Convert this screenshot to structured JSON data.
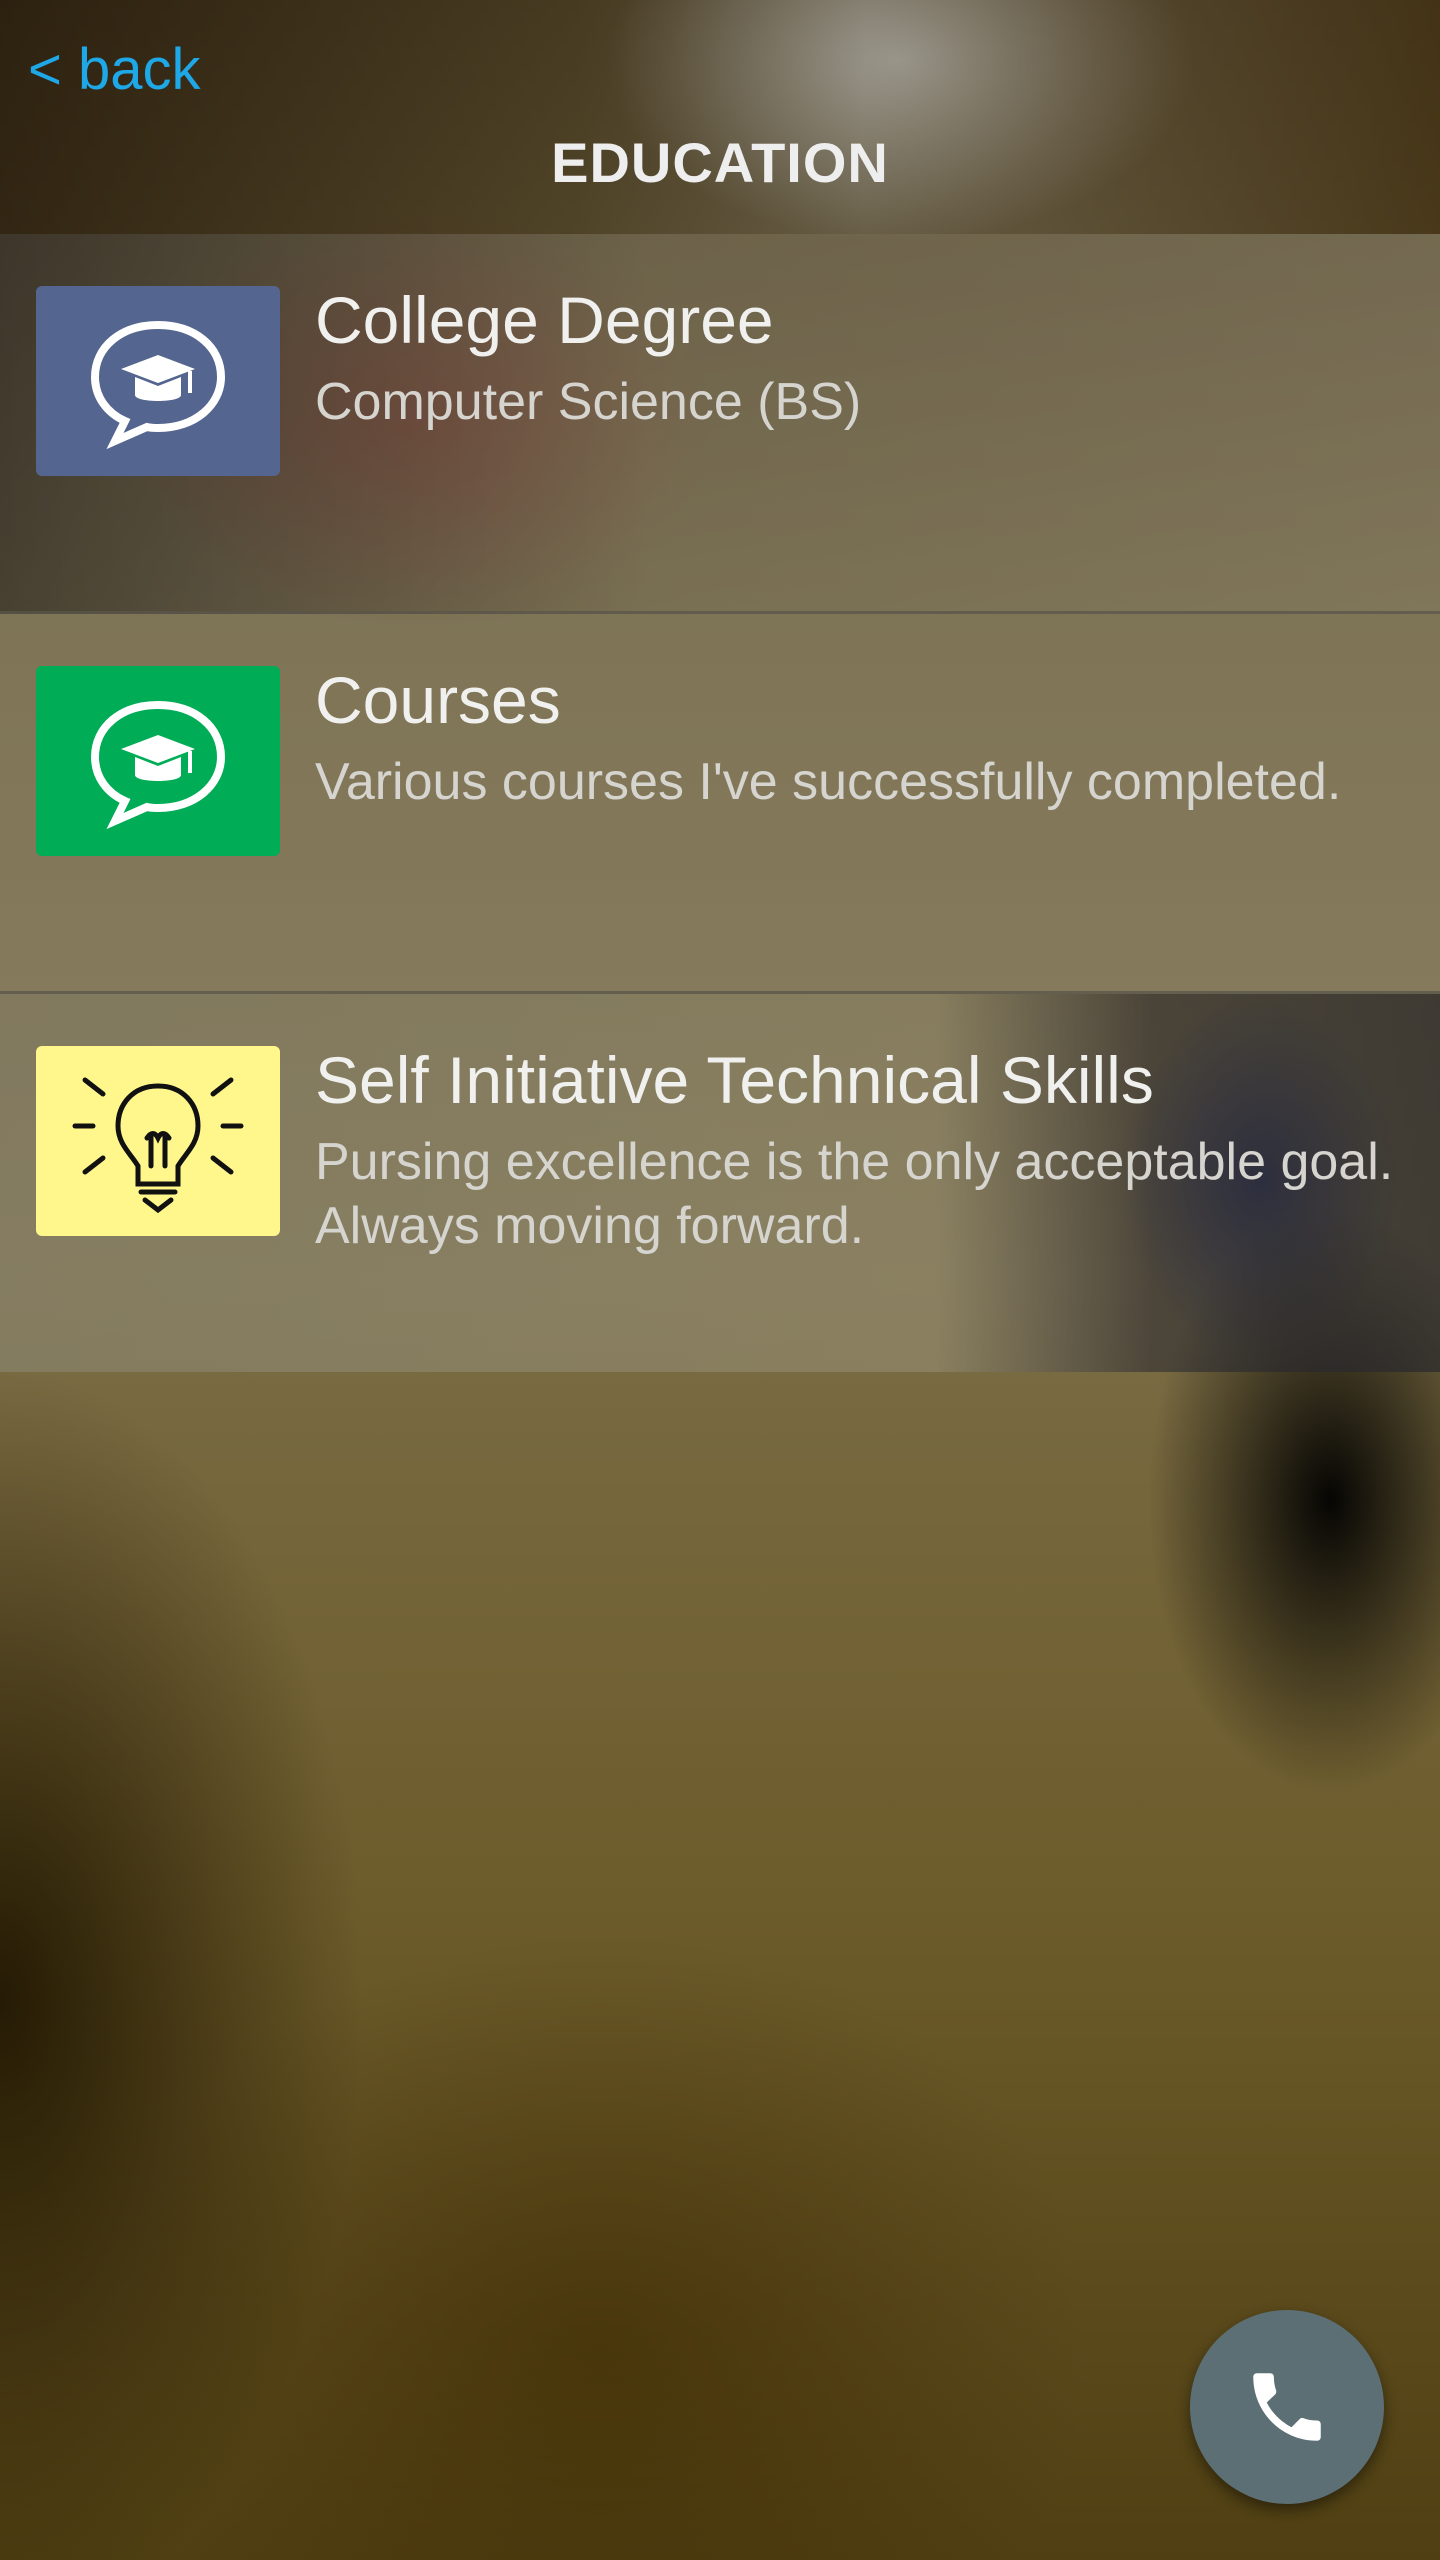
{
  "header": {
    "back_label": "< back",
    "title": "EDUCATION"
  },
  "items": [
    {
      "title": "College Degree",
      "subtitle": "Computer Science (BS)",
      "icon": "graduation-cap-chat-icon",
      "icon_bg": "#54668f"
    },
    {
      "title": "Courses",
      "subtitle": "Various courses I've successfully completed.",
      "icon": "graduation-cap-chat-icon",
      "icon_bg": "#00ad56"
    },
    {
      "title": "Self Initiative Technical Skills",
      "subtitle": "Pursing excellence is the only acceptable goal. Always moving forward.",
      "icon": "lightbulb-icon",
      "icon_bg": "#fff78c"
    }
  ],
  "fab": {
    "icon": "phone-icon",
    "color": "#5c6f74"
  },
  "colors": {
    "link": "#1fa8e8"
  }
}
